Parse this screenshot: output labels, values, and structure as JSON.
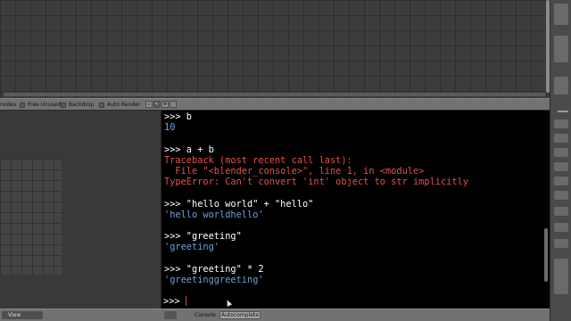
{
  "top_editor": {},
  "header": {
    "nodes_label": "nodes",
    "free_unused_label": "Free Unused",
    "backdrop_label": "Backdrop",
    "auto_render_label": "Auto Render"
  },
  "console": {
    "prompt": ">>>",
    "lines": [
      {
        "kind": "input",
        "text": ">>> b"
      },
      {
        "kind": "output",
        "text": "10"
      },
      {
        "kind": "blank",
        "text": ""
      },
      {
        "kind": "input",
        "text": ">>> a + b"
      },
      {
        "kind": "error",
        "text": "Traceback (most recent call last):"
      },
      {
        "kind": "error",
        "text": "  File \"<blender_console>\", line 1, in <module>"
      },
      {
        "kind": "error",
        "text": "TypeError: Can't convert 'int' object to str implicitly"
      },
      {
        "kind": "blank",
        "text": ""
      },
      {
        "kind": "input",
        "text": ">>> \"hello world\" + \"hello\""
      },
      {
        "kind": "output",
        "text": "'hello worldhello'"
      },
      {
        "kind": "blank",
        "text": ""
      },
      {
        "kind": "input",
        "text": ">>> \"greeting\""
      },
      {
        "kind": "output",
        "text": "'greeting'"
      },
      {
        "kind": "blank",
        "text": ""
      },
      {
        "kind": "input",
        "text": ">>> \"greeting\" * 2"
      },
      {
        "kind": "output",
        "text": "'greetinggreeting'"
      }
    ],
    "current_prompt": ">>> "
  },
  "bottom_bar": {
    "view_menu_label": "View",
    "console_label": "Console",
    "autocomplete_label": "Autocomplete"
  },
  "colors": {
    "input": "#ffffff",
    "output": "#6d9fd8",
    "error": "#e45247",
    "console_bg": "#000000"
  }
}
